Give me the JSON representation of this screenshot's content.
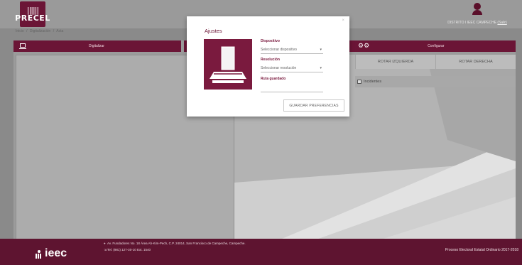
{
  "app": {
    "logo_text": "PRECEL"
  },
  "header": {
    "user_text": "DISTRITO I IEEC CAMPECHE",
    "logout_label": "(Salir)"
  },
  "breadcrumb": [
    "Inicio",
    "/",
    "Digitalización",
    "/",
    "Acta"
  ],
  "toolbar": {
    "digitize_label": "Digitalizar",
    "config_label": "Configurar",
    "rotate_left_label": "ROTAR IZQUIERDA",
    "rotate_right_label": "ROTAR DERECHA",
    "incidents_label": "Incidentes"
  },
  "modal": {
    "title": "Ajustes",
    "close_glyph": "×",
    "device_label": "Dispositivo",
    "device_value": "Seleccionar dispositivo",
    "resolution_label": "Resolución",
    "resolution_value": "Seleccionar resolución",
    "path_label": "Ruta guardado",
    "save_button": "GUARDAR PREFERENCIAS"
  },
  "footer": {
    "brand": "ieec",
    "address": "Av. Fundadores No. 18 Área Ah-Kim-Pech, C.P. 24014, San Francisco de Campeche, Campeche.",
    "phone": "Tel. (981) 127-30-10 Ext. 1540",
    "process": "Proceso Electoral Estatal Ordinario 2017-2018"
  },
  "colors": {
    "brand": "#6b1536",
    "footer": "#5e1430"
  }
}
